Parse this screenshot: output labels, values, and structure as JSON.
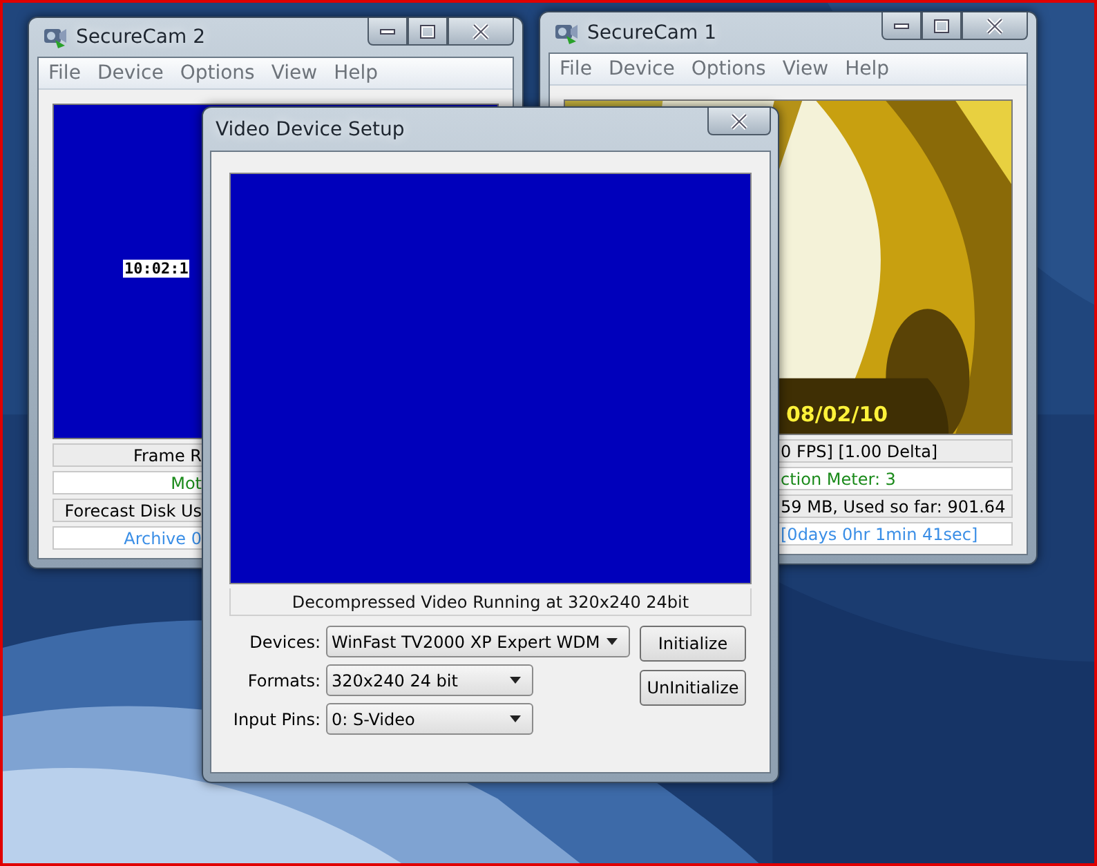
{
  "windows": [
    {
      "title": "SecureCam 2",
      "menu": [
        "File",
        "Device",
        "Options",
        "View",
        "Help"
      ],
      "preview": {
        "kind": "blank",
        "timestamp": "10:02:1"
      },
      "status_rows": [
        {
          "text": "Frame R",
          "color": "#000000"
        },
        {
          "text": "Mot",
          "color": "#1a8a1a"
        },
        {
          "text": "Forecast Disk Us",
          "color": "#000000"
        },
        {
          "text": "Archive 0",
          "color": "#3a8ee6"
        }
      ]
    },
    {
      "title": "SecureCam 1",
      "menu": [
        "File",
        "Device",
        "Options",
        "View",
        "Help"
      ],
      "preview": {
        "kind": "picture",
        "timestamp": "08/02/10"
      },
      "status_rows": [
        {
          "text": "0 FPS] [1.00 Delta]",
          "color": "#000000"
        },
        {
          "text": "ction Meter: 3",
          "color": "#1a8a1a"
        },
        {
          "text": "59 MB, Used so far: 901.64",
          "color": "#000000"
        },
        {
          "text": "[0days 0hr 1min 41sec]",
          "color": "#3a8ee6"
        }
      ]
    }
  ],
  "dialog": {
    "title": "Video Device Setup",
    "status": "Decompressed Video Running at 320x240 24bit",
    "fields": [
      {
        "label": "Devices:",
        "value": "WinFast TV2000 XP Expert WDM"
      },
      {
        "label": "Formats:",
        "value": "320x240 24 bit"
      },
      {
        "label": "Input Pins:",
        "value": "0: S-Video"
      }
    ],
    "buttons": [
      "Initialize",
      "UnInitialize"
    ]
  }
}
